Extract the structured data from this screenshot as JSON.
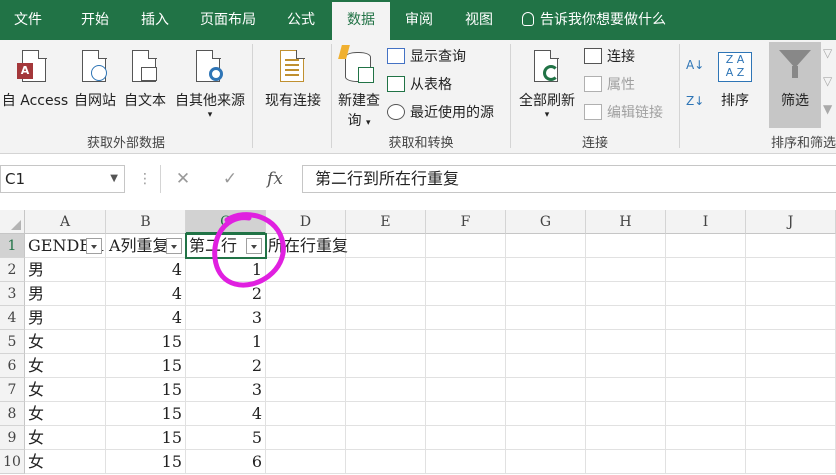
{
  "tabs": [
    "文件",
    "开始",
    "插入",
    "页面布局",
    "公式",
    "数据",
    "审阅",
    "视图"
  ],
  "active_tab": "数据",
  "tell_me": "告诉我你想要做什么",
  "ribbon": {
    "get_external": {
      "access": "自 Access",
      "web": "自网站",
      "text": "自文本",
      "other": "自其他来源",
      "group_label": "获取外部数据"
    },
    "existing_connections": "现有连接",
    "transform": {
      "new_query": "新建查",
      "new_query_2": "询",
      "show_queries": "显示查询",
      "from_table": "从表格",
      "recent_sources": "最近使用的源",
      "group_label": "获取和转换"
    },
    "connections": {
      "refresh_all": "全部刷新",
      "connections": "连接",
      "properties": "属性",
      "edit_links": "编辑链接",
      "group_label": "连接"
    },
    "sort_filter": {
      "sort": "排序",
      "filter": "筛选",
      "group_label": "排序和筛选"
    }
  },
  "formula_bar": {
    "name_box": "C1",
    "formula": "第二行到所在行重复",
    "cancel_icon": "✕",
    "enter_icon": "✓",
    "fx": "fx"
  },
  "sheet": {
    "columns": [
      "A",
      "B",
      "C",
      "D",
      "E",
      "F",
      "G",
      "H",
      "I",
      "J"
    ],
    "row_numbers": [
      "1",
      "2",
      "3",
      "4",
      "5",
      "6",
      "7",
      "8",
      "9",
      "10"
    ],
    "header_row": {
      "a": "GENDER",
      "b": "A列重复",
      "c_visible": "第二行",
      "c_overflow": "所在行重复"
    },
    "rows": [
      {
        "a": "男",
        "b": "4",
        "c": "1"
      },
      {
        "a": "男",
        "b": "4",
        "c": "2"
      },
      {
        "a": "男",
        "b": "4",
        "c": "3"
      },
      {
        "a": "女",
        "b": "15",
        "c": "1"
      },
      {
        "a": "女",
        "b": "15",
        "c": "2"
      },
      {
        "a": "女",
        "b": "15",
        "c": "3"
      },
      {
        "a": "女",
        "b": "15",
        "c": "4"
      },
      {
        "a": "女",
        "b": "15",
        "c": "5"
      },
      {
        "a": "女",
        "b": "15",
        "c": "6"
      }
    ]
  },
  "colors": {
    "excel_green": "#217346",
    "annotation": "#e020e0"
  }
}
